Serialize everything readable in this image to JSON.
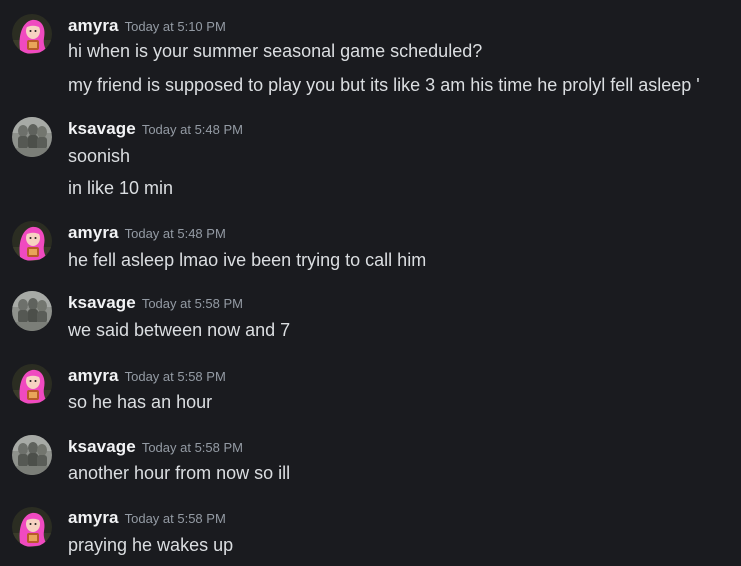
{
  "colors": {
    "background": "#1a1b1f",
    "username": "#f2f3f5",
    "timestamp": "#949ba4",
    "message_text": "#dbdee1"
  },
  "messages": [
    {
      "author": "amyra",
      "avatar": "pink-haired-character-avatar",
      "timestamp": "Today at 5:10 PM",
      "lines": [
        "hi when is your summer seasonal game scheduled?",
        "my friend is supposed to play you but its like 3 am his time he prolyl fell asleep '"
      ]
    },
    {
      "author": "ksavage",
      "avatar": "gray-photo-avatar",
      "timestamp": "Today at 5:48 PM",
      "lines": [
        "soonish",
        "in like 10 min"
      ]
    },
    {
      "author": "amyra",
      "avatar": "pink-haired-character-avatar",
      "timestamp": "Today at 5:48 PM",
      "lines": [
        "he fell asleep lmao ive been trying to call him"
      ]
    },
    {
      "author": "ksavage",
      "avatar": "gray-photo-avatar",
      "timestamp": "Today at 5:58 PM",
      "lines": [
        "we said between now and 7"
      ]
    },
    {
      "author": "amyra",
      "avatar": "pink-haired-character-avatar",
      "timestamp": "Today at 5:58 PM",
      "lines": [
        "so he has an hour"
      ]
    },
    {
      "author": "ksavage",
      "avatar": "gray-photo-avatar",
      "timestamp": "Today at 5:58 PM",
      "lines": [
        "another hour from now so ill"
      ]
    },
    {
      "author": "amyra",
      "avatar": "pink-haired-character-avatar",
      "timestamp": "Today at 5:58 PM",
      "lines": [
        "praying he wakes up"
      ]
    }
  ]
}
